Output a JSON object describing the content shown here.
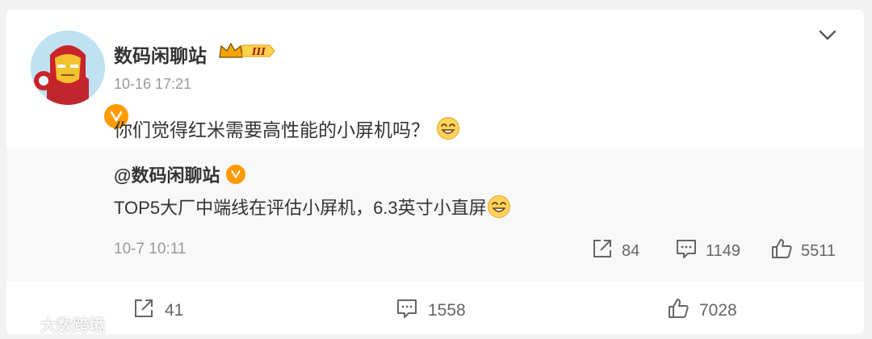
{
  "post": {
    "username": "数码闲聊站",
    "level_badge": "III",
    "time": "10-16 17:21",
    "text": "你们觉得红米需要高性能的小屏机吗？"
  },
  "quoted": {
    "username": "@数码闲聊站",
    "text": "TOP5大厂中端线在评估小屏机，6.3英寸小直屏",
    "time": "10-7 10:11",
    "reposts": "84",
    "comments": "1149",
    "likes": "5511"
  },
  "actions": {
    "reposts": "41",
    "comments": "1558",
    "likes": "7028"
  },
  "watermark": "大数跨境",
  "colors": {
    "verify": "#ff9a00",
    "text": "#333333",
    "muted": "#999999",
    "quote_bg": "#f8f8f8"
  }
}
